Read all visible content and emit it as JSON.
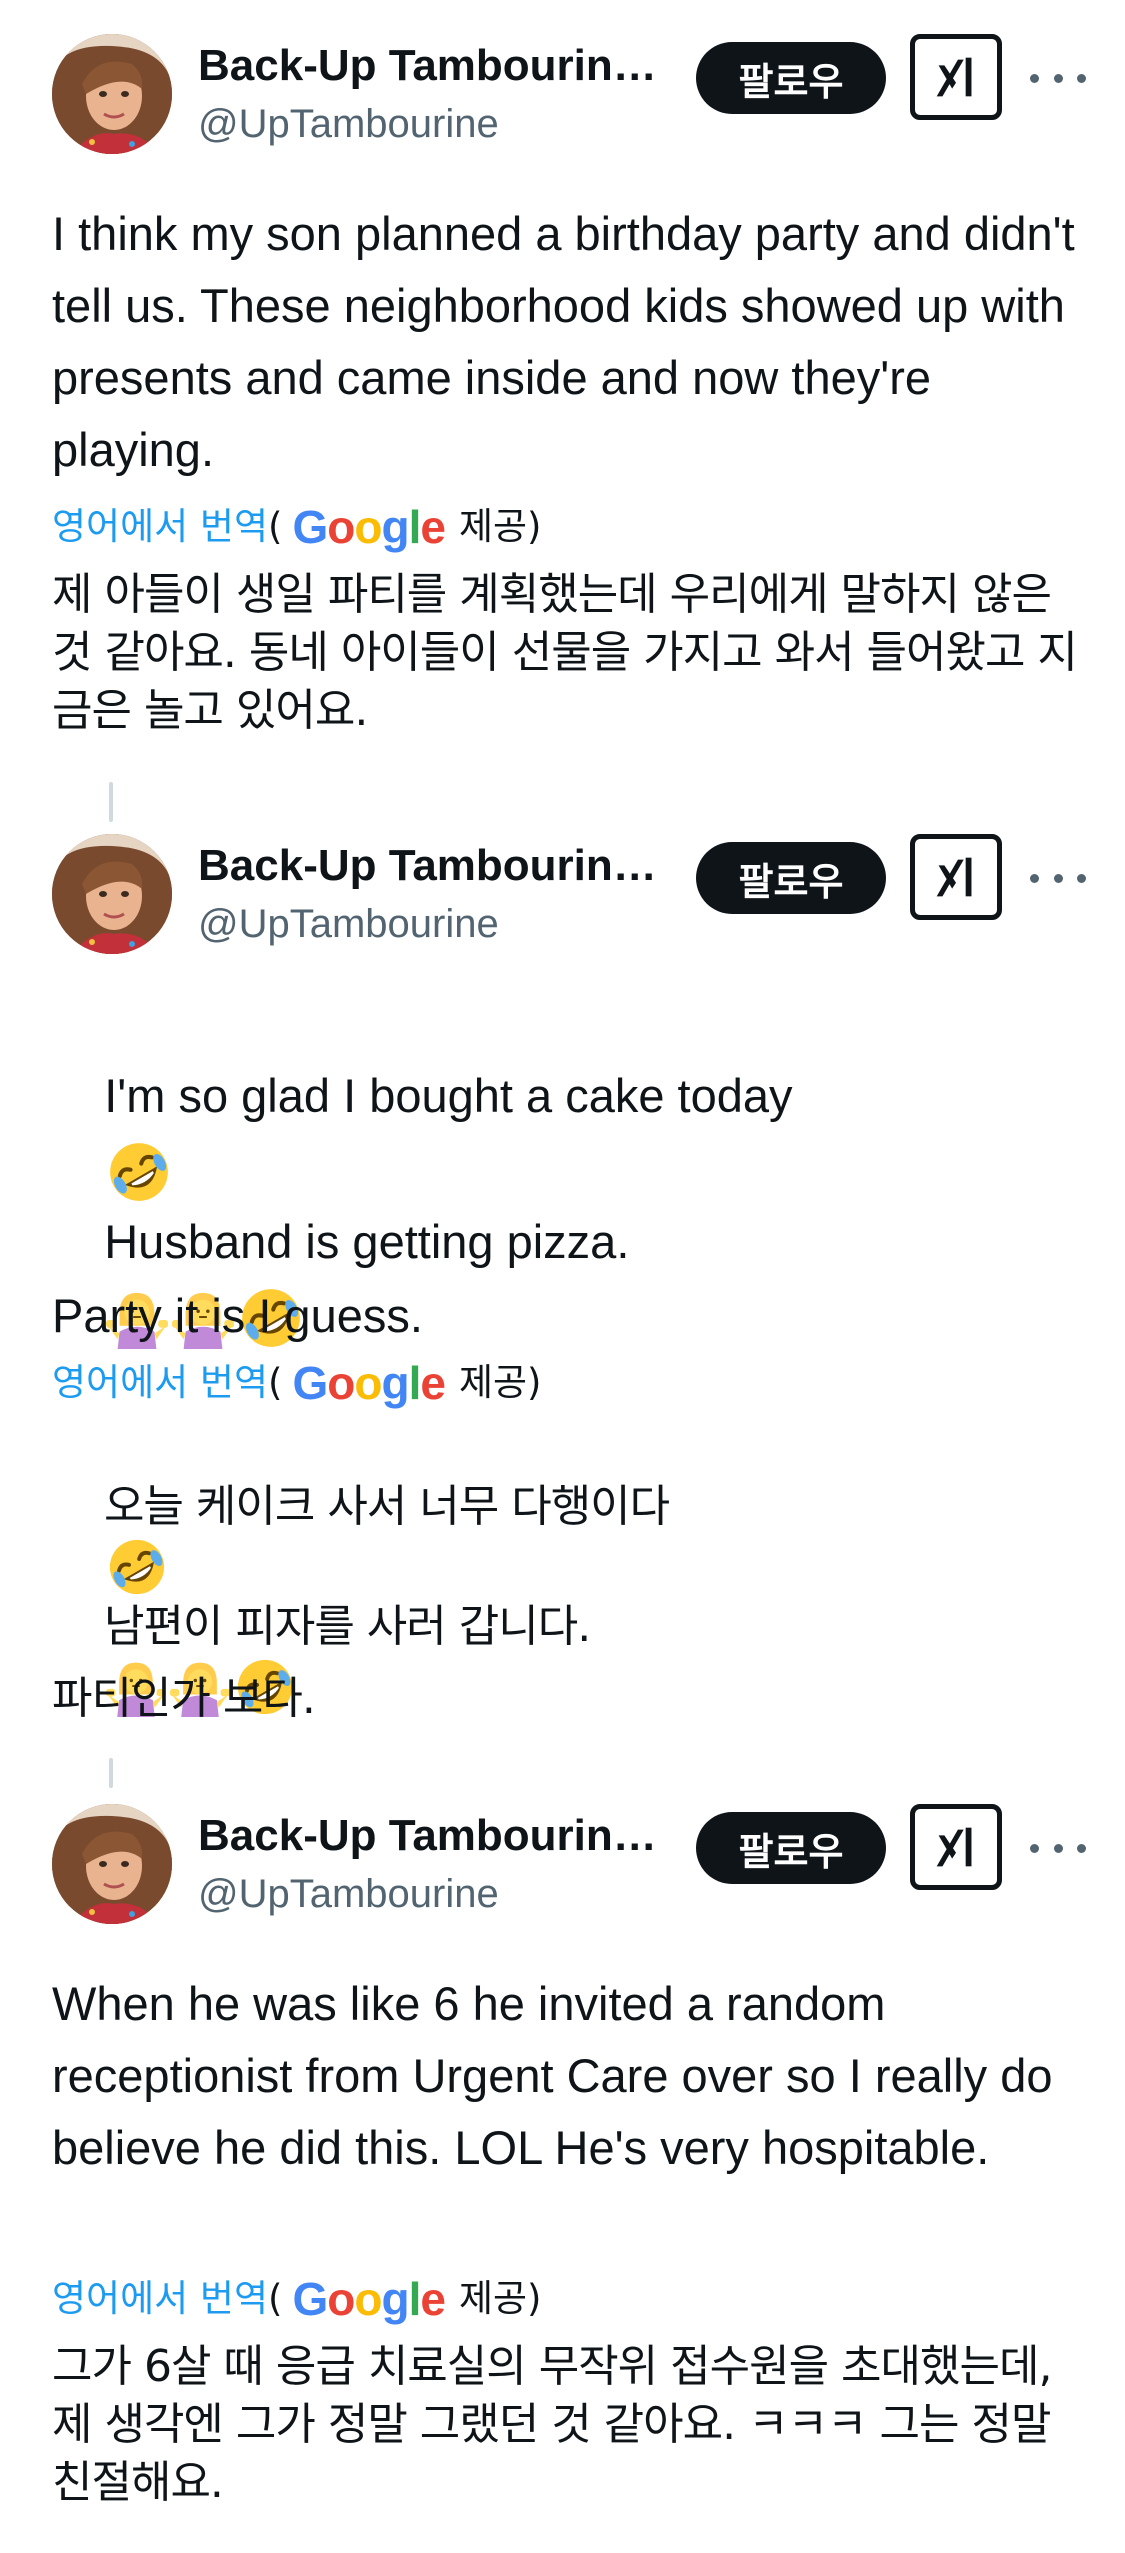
{
  "posts": [
    {
      "display_name": "Back-Up Tambourin…",
      "handle": "@UpTambourine",
      "follow_label": "팔로우",
      "text": "I think my son planned a birthday party and didn't tell us. These neighborhood kids showed up with presents and came inside and now they're playing.",
      "translate_link": "영어에서 번역",
      "translate_open": "(",
      "translate_provider": "Google",
      "translate_provided": "제공)",
      "translation": "제 아들이 생일 파티를 계획했는데 우리에게 말하지 않은 것 같아요. 동네 아이들이 선물을 가지고 와서 들어왔고 지금은 놀고 있어요."
    },
    {
      "display_name": "Back-Up Tambourin…",
      "handle": "@UpTambourine",
      "follow_label": "팔로우",
      "text_line1": "I'm so glad I bought a cake today",
      "text_line2": "Husband is getting pizza.",
      "text_line3": "Party it is I guess.",
      "translate_link": "영어에서 번역",
      "translate_open": "(",
      "translate_provider": "Google",
      "translate_provided": "제공)",
      "translation_line1": "오늘 케이크 사서 너무 다행이다",
      "translation_line2": "남편이 피자를 사러 갑니다.",
      "translation_line3": "파티인가 보다."
    },
    {
      "display_name": "Back-Up Tambourin…",
      "handle": "@UpTambourine",
      "follow_label": "팔로우",
      "text": "When he was like 6 he invited a random receptionist from Urgent Care over so I really do believe he did this. LOL He's very hospitable.",
      "translate_link": "영어에서 번역",
      "translate_open": "(",
      "translate_provider": "Google",
      "translate_provided": "제공)",
      "translation": "그가 6살 때 응급 치료실의 무작위 접수원을 초대했는데, 제 생각엔 그가 정말 그랬던 것 같아요. ㅋㅋㅋ 그는 정말 친절해요."
    }
  ],
  "icons": {
    "more": "more-dots-icon",
    "grok": "grok-icon",
    "laugh": "rolling-laughing-emoji",
    "shrug": "woman-shrugging-emoji"
  }
}
